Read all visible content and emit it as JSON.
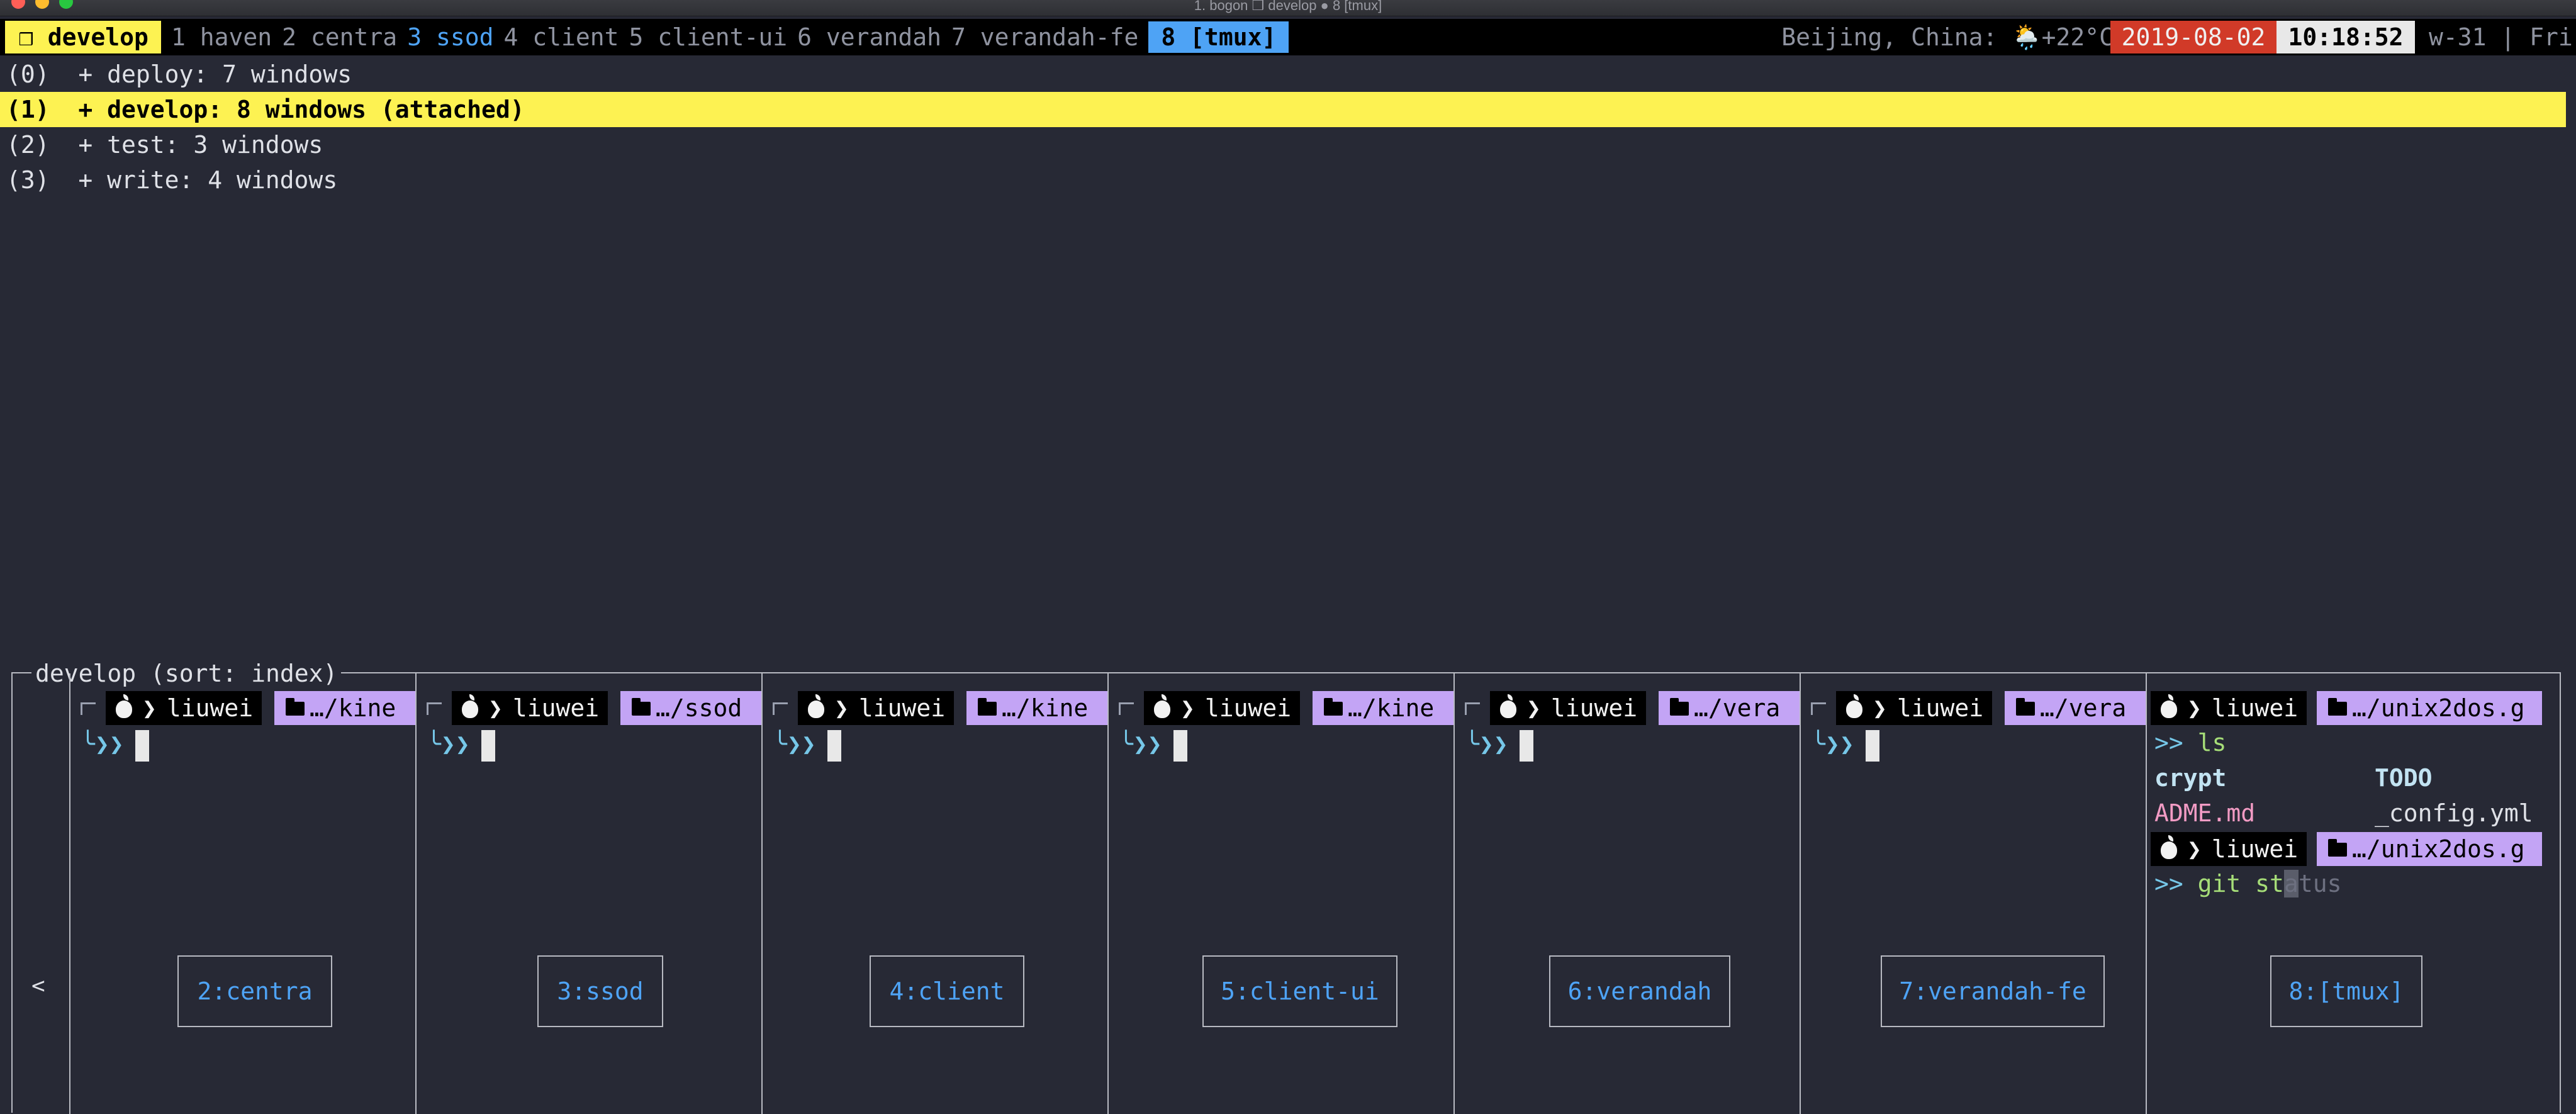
{
  "window": {
    "title": "1. bogon ❒ develop ● 8 [tmux]"
  },
  "statusbar": {
    "session": "❒ develop",
    "windows": [
      {
        "label": "1 haven",
        "state": "normal"
      },
      {
        "label": "2 centra",
        "state": "normal"
      },
      {
        "label": "3 ssod",
        "state": "last"
      },
      {
        "label": "4 client",
        "state": "normal"
      },
      {
        "label": "5 client-ui",
        "state": "normal"
      },
      {
        "label": "6 verandah",
        "state": "normal"
      },
      {
        "label": "7 verandah-fe",
        "state": "normal"
      },
      {
        "label": "8 [tmux]",
        "state": "current"
      }
    ],
    "weather": "Beijing, China: 🌦️+22°C",
    "date": "2019-08-02",
    "time": "10:18:52",
    "week": "w-31 | Fri"
  },
  "sessions": [
    {
      "text": "(0)  + deploy: 7 windows",
      "selected": false
    },
    {
      "text": "(1)  + develop: 8 windows (attached)",
      "selected": true
    },
    {
      "text": "(2)  + test: 3 windows",
      "selected": false
    },
    {
      "text": "(3)  + write: 4 windows",
      "selected": false
    }
  ],
  "preview": {
    "title": "develop (sort: index)",
    "left_arrow": "<",
    "user": "liuwei",
    "chevron": "❯",
    "continuation": "╰❯❯",
    "panes": [
      {
        "path": "…/kine",
        "label": "2:centra"
      },
      {
        "path": "…/ssod",
        "label": "3:ssod"
      },
      {
        "path": "…/kine",
        "label": "4:client"
      },
      {
        "path": "…/kine",
        "label": "5:client-ui"
      },
      {
        "path": "…/vera",
        "label": "6:verandah"
      },
      {
        "path": "…/vera",
        "label": "7:verandah-fe"
      }
    ],
    "tmux_pane": {
      "path": "…/unix2dos.g",
      "prompt": ">>",
      "cmd1": "ls",
      "files": [
        "crypt",
        "TODO",
        "ADME.md",
        "_config.yml"
      ],
      "cmd2_typed": "git st",
      "cmd2_cursor": "a",
      "cmd2_suggest": "tus",
      "label": "8:[tmux]"
    }
  },
  "colors": {
    "background": "#272935",
    "highlight": "#fdf252",
    "accent_blue": "#4ea3f5",
    "date_red": "#d13a28",
    "path_purple": "#c3a4f5"
  }
}
